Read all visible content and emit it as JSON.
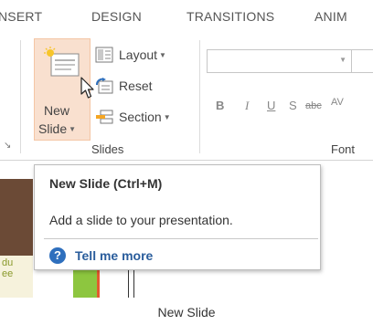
{
  "ribbon_tabs": [
    "NSERT",
    "DESIGN",
    "TRANSITIONS",
    "ANIM"
  ],
  "slides_group": {
    "new_slide_line1": "New",
    "new_slide_line2": "Slide",
    "layout_label": "Layout",
    "reset_label": "Reset",
    "section_label": "Section",
    "group_label": "Slides"
  },
  "font_group": {
    "group_label": "Font",
    "format_buttons": [
      "B",
      "I",
      "U",
      "S",
      "abc",
      "AV"
    ]
  },
  "tooltip": {
    "title": "New Slide (Ctrl+M)",
    "description": "Add a slide to your presentation.",
    "help_link": "Tell me more",
    "help_icon_glyph": "?"
  },
  "slide_pane": {
    "thumbnail_text_line1": "du",
    "thumbnail_text_line2": "ee"
  },
  "caption": "New Slide",
  "colors": {
    "new_slide_highlight": "#f9e0cf",
    "help_blue": "#2e6fbd",
    "link_blue": "#2a5d9c",
    "thumb_brown": "#6b4a36",
    "thumb_green": "#8dc63f",
    "thumb_orange": "#e35b2f"
  }
}
